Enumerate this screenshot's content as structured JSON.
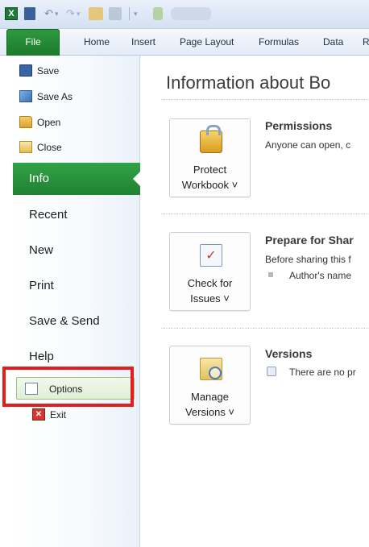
{
  "app_icon": "X",
  "quick_access_toolbar": {
    "icons": [
      "excel-icon",
      "save-icon",
      "undo-icon",
      "redo-icon",
      "open-icon",
      "print-icon",
      "customize-icon"
    ]
  },
  "ribbon_tabs": [
    "File",
    "Home",
    "Insert",
    "Page Layout",
    "Formulas",
    "Data",
    "R"
  ],
  "nav": {
    "commands": [
      {
        "label": "Save",
        "icon": "save-icon"
      },
      {
        "label": "Save As",
        "icon": "save-as-icon"
      },
      {
        "label": "Open",
        "icon": "open-folder-icon"
      },
      {
        "label": "Close",
        "icon": "close-folder-icon"
      }
    ],
    "selected_tab": "Info",
    "tabs": [
      "Recent",
      "New",
      "Print",
      "Save & Send",
      "Help"
    ],
    "options_label": "Options",
    "exit_label": "Exit"
  },
  "main": {
    "title": "Information about Bo",
    "sections": [
      {
        "button_line1": "Protect",
        "button_line2": "Workbook ˅",
        "heading": "Permissions",
        "text": "Anyone can open, c",
        "icon": "lock-icon"
      },
      {
        "button_line1": "Check for",
        "button_line2": "Issues ˅",
        "heading": "Prepare for Shar",
        "text": "Before sharing this f",
        "item": "Author's name",
        "icon": "document-check-icon"
      },
      {
        "button_line1": "Manage",
        "button_line2": "Versions ˅",
        "heading": "Versions",
        "text": "There are no pr",
        "icon": "versions-icon"
      }
    ]
  },
  "colors": {
    "file_tab_green": "#1f8232",
    "highlight_red": "#e11d1d",
    "options_hover": "#e1efd6"
  }
}
